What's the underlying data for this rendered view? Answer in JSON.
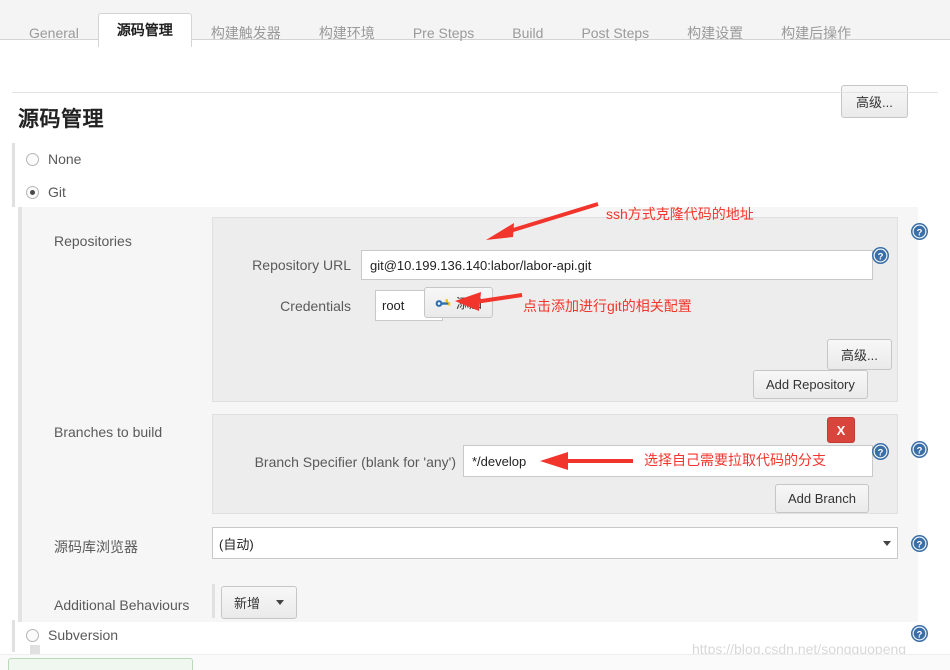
{
  "tabs": [
    {
      "label": "General",
      "active": false
    },
    {
      "label": "源码管理",
      "active": true
    },
    {
      "label": "构建触发器",
      "active": false
    },
    {
      "label": "构建环境",
      "active": false
    },
    {
      "label": "Pre Steps",
      "active": false
    },
    {
      "label": "Build",
      "active": false
    },
    {
      "label": "Post Steps",
      "active": false
    },
    {
      "label": "构建设置",
      "active": false
    },
    {
      "label": "构建后操作",
      "active": false
    }
  ],
  "toolbar": {
    "advanced_label": "高级..."
  },
  "section": {
    "title": "源码管理"
  },
  "scm_options": [
    {
      "label": "None",
      "selected": false
    },
    {
      "label": "Git",
      "selected": true
    },
    {
      "label": "Subversion",
      "selected": false
    }
  ],
  "git": {
    "repositories": {
      "label": "Repositories",
      "repository_url": {
        "label": "Repository URL",
        "value": "git@10.199.136.140:labor/labor-api.git"
      },
      "credentials": {
        "label": "Credentials",
        "selected": "root",
        "add_button": "添加"
      },
      "advanced_label": "高级...",
      "add_repository_label": "Add Repository"
    },
    "branches": {
      "label": "Branches to build",
      "branch_specifier": {
        "label": "Branch Specifier (blank for 'any')",
        "value": "*/develop"
      },
      "delete_label": "X",
      "add_branch_label": "Add Branch"
    },
    "browser": {
      "label": "源码库浏览器",
      "selected": "(自动)"
    },
    "additional_behaviours": {
      "label": "Additional Behaviours",
      "add_label": "新增"
    }
  },
  "annotations": [
    {
      "text": "ssh方式克隆代码的地址"
    },
    {
      "text": "点击添加进行git的相关配置"
    },
    {
      "text": "选择自己需要拉取代码的分支"
    }
  ],
  "watermark": {
    "text": "https://blog.csdn.net/songguopeng"
  },
  "colors": {
    "annotation_red": "#f2352c",
    "delete_red": "#d9443c",
    "help_blue": "#3b6fa8"
  }
}
